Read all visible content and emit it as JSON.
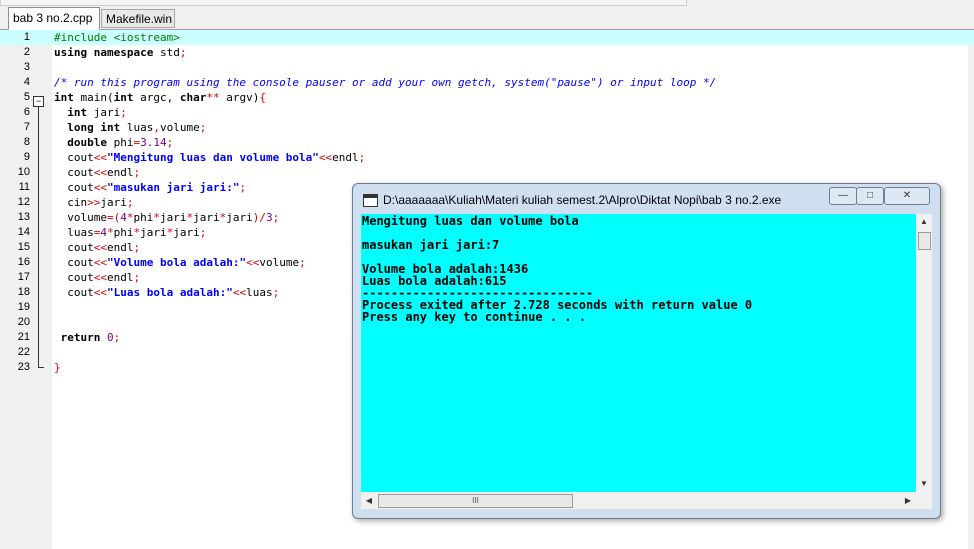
{
  "tabs": [
    {
      "label": "bab 3 no.2.cpp",
      "active": true
    },
    {
      "label": "Makefile.win",
      "active": false
    }
  ],
  "editor": {
    "lines": [
      {
        "num": "1",
        "html": "<span style='color:#008000'>#include &lt;iostream&gt;</span>"
      },
      {
        "num": "2",
        "html": "<b>using namespace</b> std<span style='color:#e00000'>;</span>"
      },
      {
        "num": "3",
        "html": ""
      },
      {
        "num": "4",
        "html": "<span style='color:#0000ff;font-style:italic'>/* run this program using the console pauser or add your own getch, system(\"pause\") or input loop */</span>"
      },
      {
        "num": "5",
        "html": "<b>int</b> main(<b>int</b> argc, <b>char</b><span style='color:#e00000'>**</span> argv)<span style='color:#e00000'>{</span>"
      },
      {
        "num": "6",
        "html": "  <b>int</b> jari<span style='color:#e00000'>;</span>"
      },
      {
        "num": "7",
        "html": "  <b>long int</b> luas<span style='color:#e00000'>,</span>volume<span style='color:#e00000'>;</span>"
      },
      {
        "num": "8",
        "html": "  <b>double</b> phi<span style='color:#e00000'>=</span><span style='color:#800080'>3.14</span><span style='color:#e00000'>;</span>"
      },
      {
        "num": "9",
        "html": "  cout<span style='color:#e00000'>&lt;&lt;</span><b style='color:#0000ff'>\"Mengitung luas dan volume bola\"</b><span style='color:#e00000'>&lt;&lt;</span>endl<span style='color:#e00000'>;</span>"
      },
      {
        "num": "10",
        "html": "  cout<span style='color:#e00000'>&lt;&lt;</span>endl<span style='color:#e00000'>;</span>"
      },
      {
        "num": "11",
        "html": "  cout<span style='color:#e00000'>&lt;&lt;</span><b style='color:#0000ff'>\"masukan jari jari:\"</b><span style='color:#e00000'>;</span>"
      },
      {
        "num": "12",
        "html": "  cin<span style='color:#e00000'>&gt;&gt;</span>jari<span style='color:#e00000'>;</span>"
      },
      {
        "num": "13",
        "html": "  volume<span style='color:#e00000'>=(</span><span style='color:#800080'>4</span><span style='color:#e00000'>*</span>phi<span style='color:#e00000'>*</span>jari<span style='color:#e00000'>*</span>jari<span style='color:#e00000'>*</span>jari<span style='color:#e00000'>)/</span><span style='color:#800080'>3</span><span style='color:#e00000'>;</span>"
      },
      {
        "num": "14",
        "html": "  luas<span style='color:#e00000'>=</span><span style='color:#800080'>4</span><span style='color:#e00000'>*</span>phi<span style='color:#e00000'>*</span>jari<span style='color:#e00000'>*</span>jari<span style='color:#e00000'>;</span>"
      },
      {
        "num": "15",
        "html": "  cout<span style='color:#e00000'>&lt;&lt;</span>endl<span style='color:#e00000'>;</span>"
      },
      {
        "num": "16",
        "html": "  cout<span style='color:#e00000'>&lt;&lt;</span><b style='color:#0000ff'>\"Volume bola adalah:\"</b><span style='color:#e00000'>&lt;&lt;</span>volume<span style='color:#e00000'>;</span>"
      },
      {
        "num": "17",
        "html": "  cout<span style='color:#e00000'>&lt;&lt;</span>endl<span style='color:#e00000'>;</span>"
      },
      {
        "num": "18",
        "html": "  cout<span style='color:#e00000'>&lt;&lt;</span><b style='color:#0000ff'>\"Luas bola adalah:\"</b><span style='color:#e00000'>&lt;&lt;</span>luas<span style='color:#e00000'>;</span>"
      },
      {
        "num": "19",
        "html": ""
      },
      {
        "num": "20",
        "html": ""
      },
      {
        "num": "21",
        "html": " <b>return</b> <span style='color:#800080'>0</span><span style='color:#e00000'>;</span>"
      },
      {
        "num": "22",
        "html": ""
      },
      {
        "num": "23",
        "html": "<span style='color:#e00000'>}</span>"
      }
    ]
  },
  "console_window": {
    "title": "D:\\aaaaaaa\\Kuliah\\Materi kuliah semest.2\\Alpro\\Diktat Nopi\\bab 3 no.2.exe",
    "min_label": "—",
    "max_label": "□",
    "close_label": "✕",
    "output": [
      "Mengitung luas dan volume bola",
      "",
      "masukan jari jari:7",
      "",
      "Volume bola adalah:1436",
      "Luas bola adalah:615",
      "--------------------------------",
      "Process exited after 2.728 seconds with return value 0",
      "Press any key to continue . . ."
    ],
    "hscroll_thumb_label": "III"
  }
}
